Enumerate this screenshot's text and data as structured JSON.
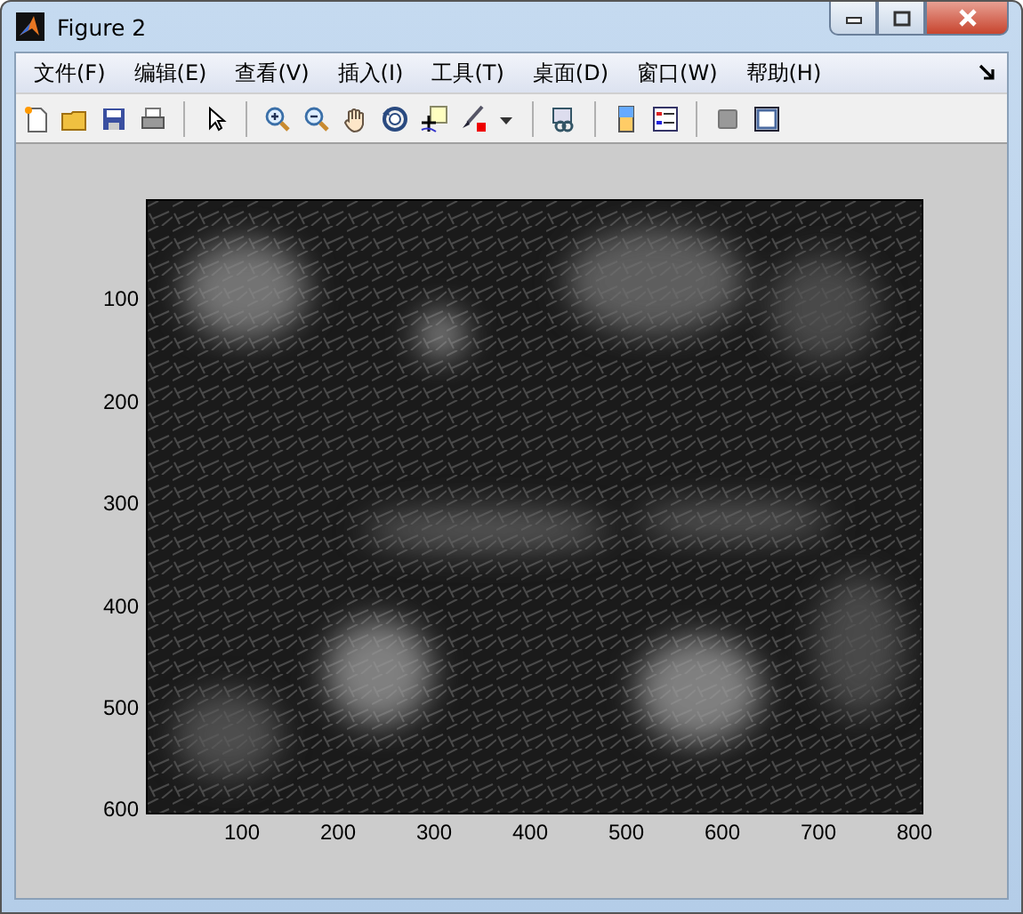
{
  "window": {
    "title": "Figure 2"
  },
  "menu": [
    "文件(F)",
    "编辑(E)",
    "查看(V)",
    "插入(I)",
    "工具(T)",
    "桌面(D)",
    "窗口(W)",
    "帮助(H)"
  ],
  "axes": {
    "yticks": [
      "100",
      "200",
      "300",
      "400",
      "500",
      "600"
    ],
    "xticks": [
      "100",
      "200",
      "300",
      "400",
      "500",
      "600",
      "700",
      "800"
    ]
  }
}
